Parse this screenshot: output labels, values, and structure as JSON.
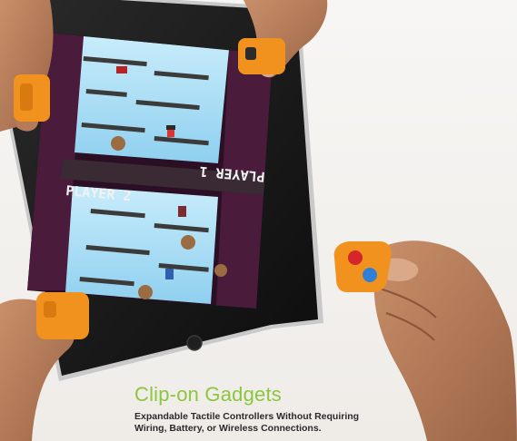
{
  "caption": {
    "title": "Clip-on Gadgets",
    "subtitle_line1": "Expandable Tactile Controllers Without Requiring",
    "subtitle_line2": "Wiring, Battery, or Wireless Connections."
  },
  "game": {
    "player_top_label": "PLAYER 1",
    "player_bottom_label": "PLAYER 2"
  },
  "colors": {
    "caption_title": "#8bc63f",
    "gadget_orange": "#f2921e",
    "button_red": "#d5262b",
    "button_blue": "#2f7fd6",
    "tablet_frame": "#161616",
    "sky": "#a9dcf4"
  }
}
